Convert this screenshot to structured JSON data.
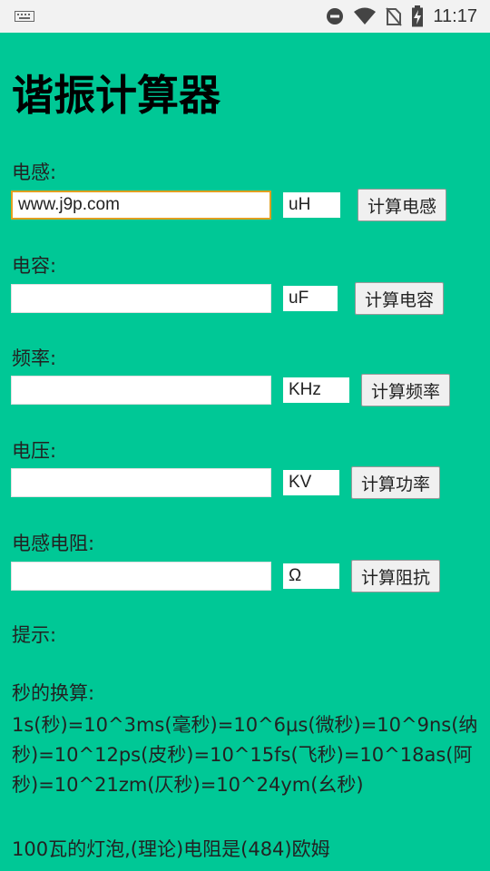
{
  "status_bar": {
    "time": "11:17"
  },
  "app": {
    "title": "谐振计算器"
  },
  "fields": [
    {
      "label": "电感:",
      "value": "www.j9p.com",
      "unit": "uH",
      "button": "计算电感"
    },
    {
      "label": "电容:",
      "value": "",
      "unit": "uF",
      "button": "计算电容"
    },
    {
      "label": "频率:",
      "value": "",
      "unit": "KHz",
      "button": "计算频率"
    },
    {
      "label": "电压:",
      "value": "",
      "unit": "KV",
      "button": "计算功率"
    },
    {
      "label": "电感电阻:",
      "value": "",
      "unit": "Ω",
      "button": "计算阻抗"
    }
  ],
  "tips": {
    "heading": "提示:",
    "conversion_title": "秒的换算:",
    "conversion_text": "1s(秒)=10^3ms(毫秒)=10^6μs(微秒)=10^9ns(纳秒)=10^12ps(皮秒)=10^15fs(飞秒)=10^18as(阿秒)=10^21zm(仄秒)=10^24ym(幺秒)",
    "bulb_text": "100瓦的灯泡,(理论)电阻是(484)欧姆"
  }
}
